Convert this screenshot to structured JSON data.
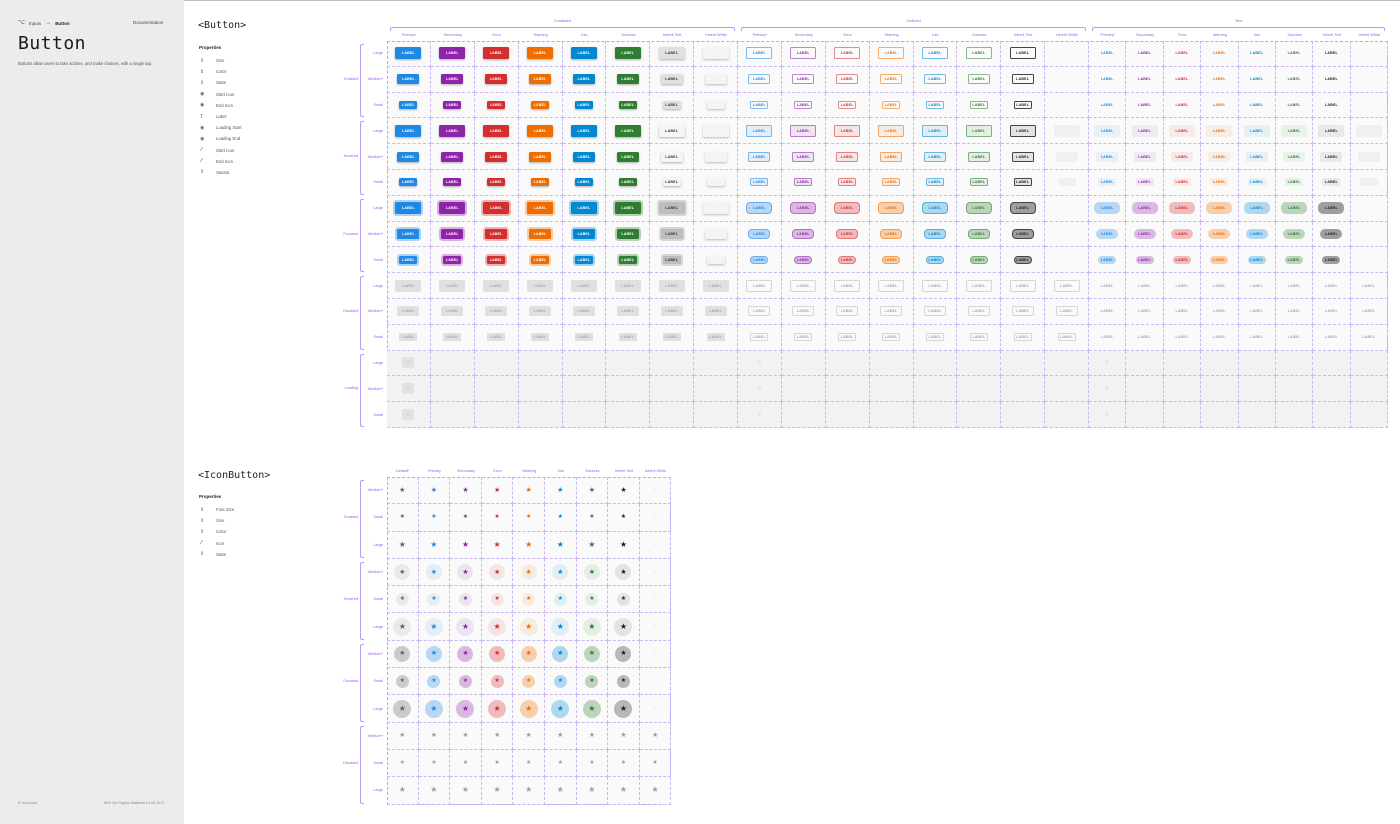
{
  "sidebar": {
    "breadcrumb": {
      "parent": "Inputs",
      "current": "Button"
    },
    "documentation_link": "Documentation",
    "title": "Button",
    "description": "Buttons allow users to take actions, and make choices, with a single tap.",
    "footer_left": "© mui.com",
    "footer_right": "MUI for Figma Material UI v5.16.0"
  },
  "button_section": {
    "title": "<Button>",
    "properties_heading": "Properties",
    "properties": [
      {
        "icon": "variant-icon",
        "glyph": "⇕",
        "label": "Size"
      },
      {
        "icon": "variant-icon",
        "glyph": "⇕",
        "label": "Color"
      },
      {
        "icon": "variant-icon",
        "glyph": "⇕",
        "label": "State"
      },
      {
        "icon": "eye-icon",
        "glyph": "◉",
        "label": "Start Icon"
      },
      {
        "icon": "eye-icon",
        "glyph": "◉",
        "label": "End Icon"
      },
      {
        "icon": "text-icon",
        "glyph": "T",
        "label": "Label"
      },
      {
        "icon": "eye-icon",
        "glyph": "◉",
        "label": "Loading Start"
      },
      {
        "icon": "eye-icon",
        "glyph": "◉",
        "label": "Loading End"
      },
      {
        "icon": "swap-icon",
        "glyph": "⤤",
        "label": "Start Icon"
      },
      {
        "icon": "swap-icon",
        "glyph": "⤤",
        "label": "End Icon"
      },
      {
        "icon": "variant-icon",
        "glyph": "⇕",
        "label": "Variant"
      }
    ],
    "groups": [
      {
        "name": "Contained",
        "columns": [
          "Primary*",
          "Secondary",
          "Error",
          "Warning",
          "Info",
          "Success",
          "Inherit Text",
          "Inherit White"
        ]
      },
      {
        "name": "Outlined",
        "columns": [
          "Primary*",
          "Secondary",
          "Error",
          "Warning",
          "Info",
          "Success",
          "Inherit Text",
          "Inherit White"
        ]
      },
      {
        "name": "Text",
        "columns": [
          "Primary*",
          "Secondary",
          "Error",
          "Warning",
          "Info",
          "Success",
          "Inherit Text",
          "Inherit White"
        ]
      }
    ],
    "states": [
      "Enabled",
      "Hovered",
      "Focused",
      "Disabled",
      "Loading"
    ],
    "sizes": [
      "Large",
      "Medium*",
      "Small"
    ],
    "button_label": "LABEL",
    "loading_glyph": "◌"
  },
  "iconbutton_section": {
    "title": "<IconButton>",
    "properties_heading": "Properties",
    "properties": [
      {
        "icon": "variant-icon",
        "glyph": "⇕",
        "label": "Font Size"
      },
      {
        "icon": "variant-icon",
        "glyph": "⇕",
        "label": "Size"
      },
      {
        "icon": "variant-icon",
        "glyph": "⇕",
        "label": "Color"
      },
      {
        "icon": "swap-icon",
        "glyph": "⤤",
        "label": "Icon"
      },
      {
        "icon": "variant-icon",
        "glyph": "⇕",
        "label": "State"
      }
    ],
    "columns": [
      "Default*",
      "Primary",
      "Secondary",
      "Error",
      "Warning",
      "Info",
      "Success",
      "Inherit Text",
      "Inherit White"
    ],
    "states": [
      "Enabled",
      "Hovered",
      "Focused",
      "Disabled"
    ],
    "sizes": [
      "Medium*",
      "Small",
      "Large"
    ],
    "star_glyph": "★"
  },
  "colors": {
    "primary": "#1e88e5",
    "secondary": "#8e24aa",
    "error": "#d32f2f",
    "warning": "#ef6c00",
    "info": "#0288d1",
    "success": "#2e7d32",
    "inherit_text": "#212121",
    "inherit_white": "#ffffff",
    "default": "#616161",
    "disabled": "#bdbdbd",
    "accent": "#9a5cf0"
  }
}
